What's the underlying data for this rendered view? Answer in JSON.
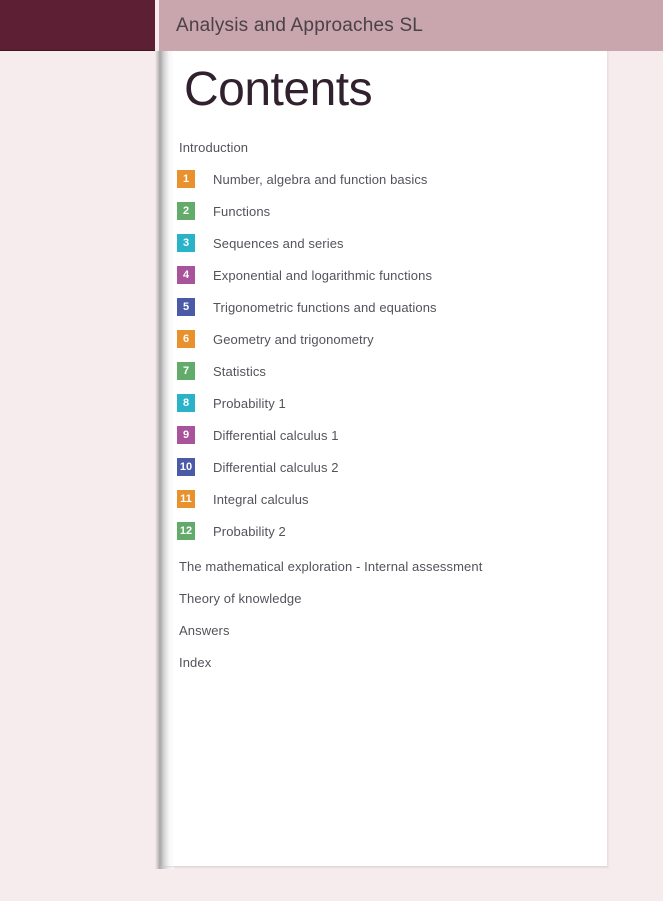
{
  "header": {
    "title": "Analysis and Approaches SL",
    "bar_color": "#c9a5ad",
    "brand_block_color": "#5d1f34"
  },
  "page": {
    "background": "#ffffff",
    "surround_background": "#f6ebed",
    "title": "Contents",
    "title_color": "#31202e"
  },
  "contents": {
    "intro_label": "Introduction",
    "chapters": [
      {
        "number": "1",
        "label": "Number, algebra and function basics",
        "color": "#e8912d"
      },
      {
        "number": "2",
        "label": "Functions",
        "color": "#63ab6a"
      },
      {
        "number": "3",
        "label": "Sequences and series",
        "color": "#29b3c9"
      },
      {
        "number": "4",
        "label": "Exponential and logarithmic functions",
        "color": "#a8539b"
      },
      {
        "number": "5",
        "label": "Trigonometric functions and equations",
        "color": "#4a5aa8"
      },
      {
        "number": "6",
        "label": "Geometry and trigonometry",
        "color": "#e8912d"
      },
      {
        "number": "7",
        "label": "Statistics",
        "color": "#63ab6a"
      },
      {
        "number": "8",
        "label": "Probability 1",
        "color": "#29b3c9"
      },
      {
        "number": "9",
        "label": "Differential calculus 1",
        "color": "#a8539b"
      },
      {
        "number": "10",
        "label": "Differential calculus 2",
        "color": "#4a5aa8"
      },
      {
        "number": "11",
        "label": "Integral calculus",
        "color": "#e8912d"
      },
      {
        "number": "12",
        "label": "Probability 2",
        "color": "#63ab6a"
      }
    ],
    "back_matter": [
      "The mathematical exploration - Internal assessment",
      "Theory of knowledge",
      "Answers",
      "Index"
    ]
  }
}
